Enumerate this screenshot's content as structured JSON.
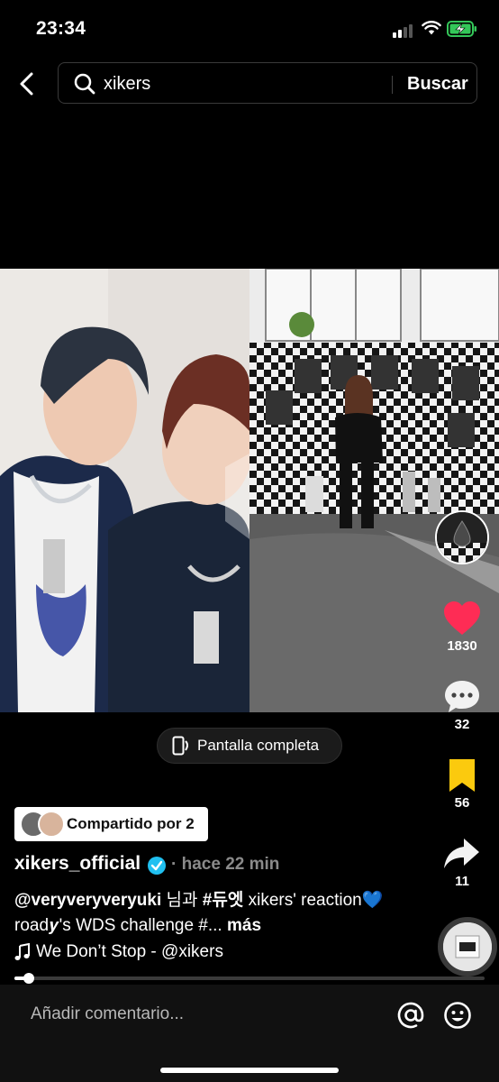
{
  "status_bar": {
    "time": "23:34"
  },
  "search": {
    "query": "xikers",
    "button_label": "Buscar"
  },
  "actions": {
    "likes": "1830",
    "comments": "32",
    "saves": "56",
    "shares": "11",
    "like_color": "#fe2c55",
    "save_color": "#fbca0e"
  },
  "fullscreen_label": "Pantalla completa",
  "shared_chip_label": "Compartido por 2",
  "post": {
    "username": "xikers_official",
    "age": "· hace 22 min",
    "caption_mention": "@veryveryveryuki",
    "caption_text_1": " 님과 ",
    "caption_hashtag": "#듀엣",
    "caption_text_2": " xikers' reaction",
    "caption_heart": "💙",
    "caption_text_3": " road𝒚's WDS challenge #...",
    "caption_more": " más",
    "music": "We Don’t Stop - @xikers"
  },
  "progress": {
    "fraction": 0.03
  },
  "comment": {
    "placeholder": "Añadir comentario..."
  }
}
